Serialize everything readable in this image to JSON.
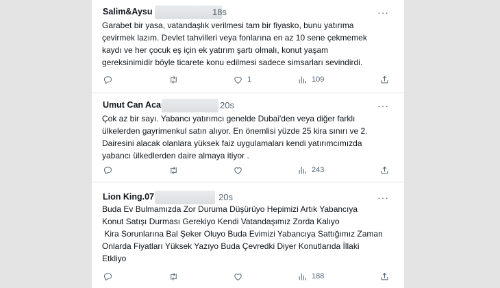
{
  "tweets": [
    {
      "author": "Salim&Aysu",
      "time": "18s",
      "lines": [
        "Garabet bir yasa, vatandaşlık verilmesi tam bir fiyasko, bunu yatırıma",
        "çevirmek lazım. Devlet tahvilleri veya fonlarına en az 10 sene çekmemek",
        "kaydı ve her çocuk eş için ek yatırım şartı olmalı, konut yaşam",
        "gereksinimidir böyle ticarete konu edilmesi sadece simsarları sevindirdi."
      ],
      "replies": "",
      "retweets": "",
      "likes": "1",
      "views": "109"
    },
    {
      "author": "Umut Can Acar",
      "time": "20s",
      "lines": [
        "Çok az bir sayı. Yabancı yatırımcı genelde Dubai'den veya diğer farklı",
        "ülkelerden gayrimenkul satın alıyor. En önemlisi yüzde 25 kira sınırı ve 2.",
        "Dairesini alacak olanlara yüksek faiz uygulamaları kendi yatırımcımızda",
        "yabancı ülkedlerden daire almaya itiyor ."
      ],
      "replies": "",
      "retweets": "",
      "likes": "",
      "views": "243"
    },
    {
      "author": "Lion King.07",
      "time": "20s",
      "lines": [
        "Buda Ev Bulmamızda Zor Duruma Düşürüyo Hepimizi Artık Yabancıya",
        "Konut Satışı Durması Gerekiyo Kendi Vatandaşımız Zorda Kalıyo",
        " Kira Sorunlarına Bal Şeker Oluyo Buda Evimizi Yabancıya Sattığımız Zaman",
        "Onlarda Fiyatları Yüksek Yazıyo Buda Çevredki Diyer Konutlarıda İllaki",
        "Etkliyo"
      ],
      "replies": "",
      "retweets": "",
      "likes": "",
      "views": "188"
    }
  ],
  "icons": {
    "reply": "reply-icon",
    "retweet": "retweet-icon",
    "like": "heart-icon",
    "views": "views-icon",
    "share": "share-icon",
    "more": "more-icon"
  },
  "more_glyph": "···"
}
